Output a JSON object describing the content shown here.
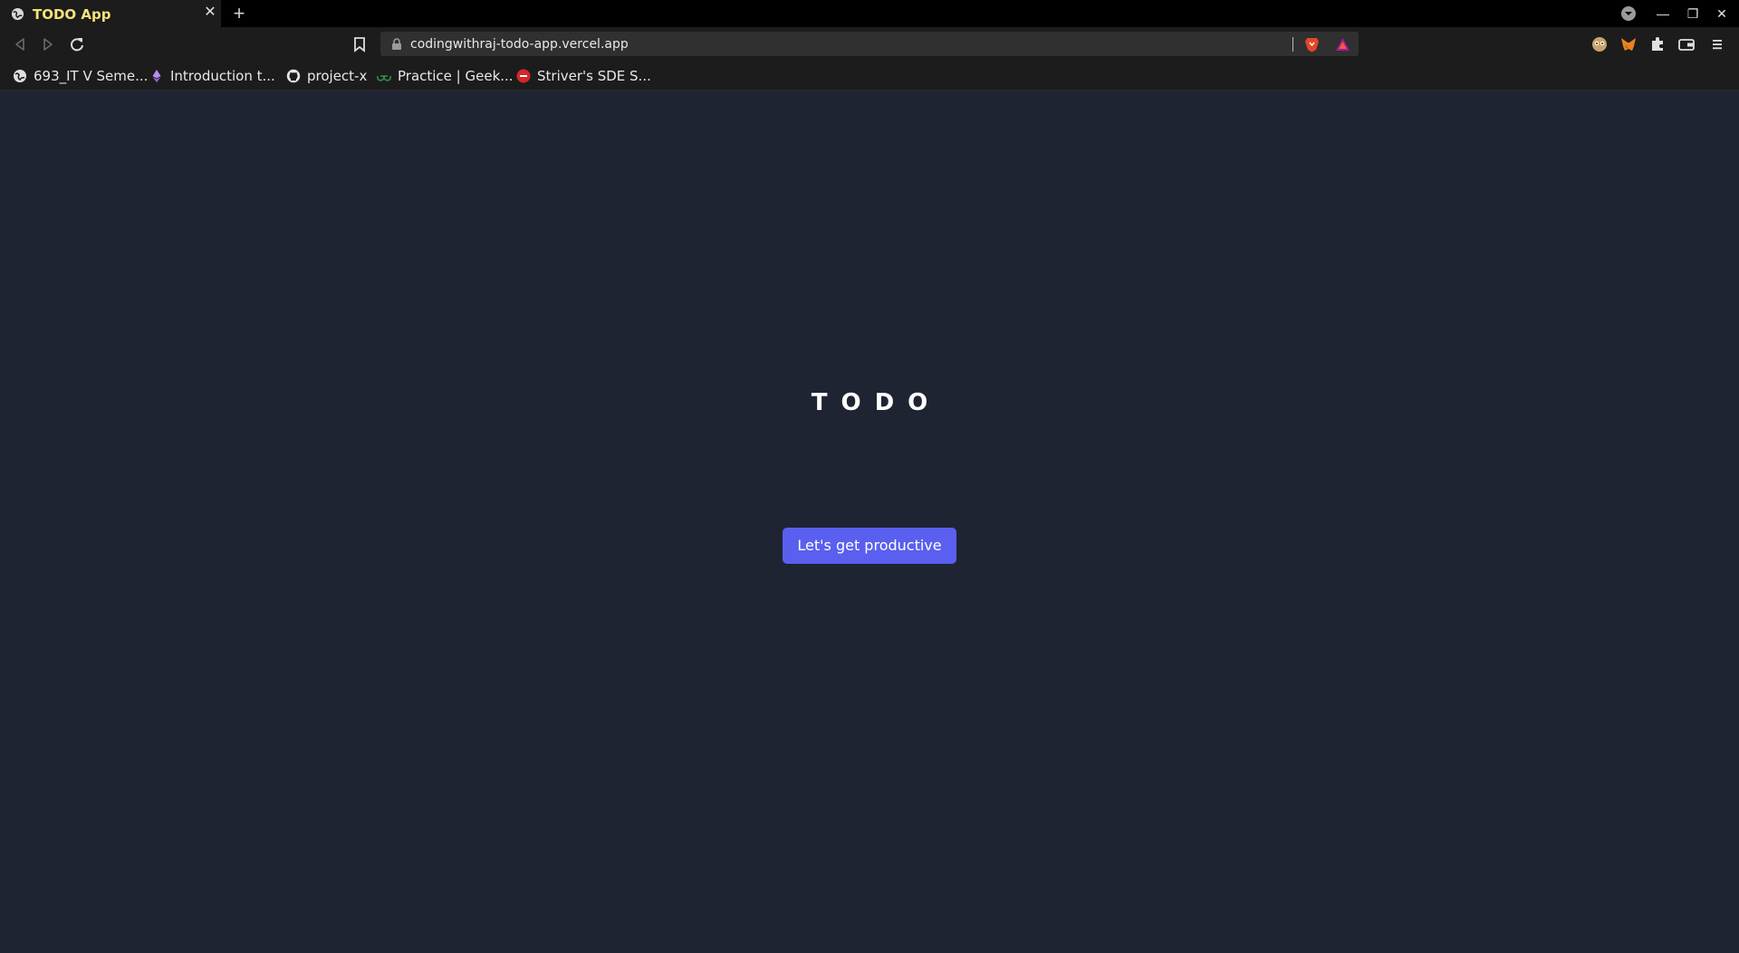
{
  "tab": {
    "title": "TODO App",
    "close_glyph": "✕",
    "new_tab_glyph": "+"
  },
  "window_controls": {
    "dropdown_icon": "chevron-down-circle-icon",
    "minimize_glyph": "—",
    "maximize_glyph": "❐",
    "close_glyph": "✕"
  },
  "toolbar": {
    "url": "codingwithraj-todo-app.vercel.app"
  },
  "bookmarks": [
    {
      "label": "693_IT V Seme...",
      "icon": "globe-icon"
    },
    {
      "label": "Introduction t...",
      "icon": "ethereum-icon"
    },
    {
      "label": "project-x",
      "icon": "github-icon"
    },
    {
      "label": "Practice | Geek...",
      "icon": "geeksforgeeks-icon"
    },
    {
      "label": "Striver's SDE S...",
      "icon": "takeuforward-icon"
    }
  ],
  "page": {
    "title": "TODO",
    "cta_label": "Let's get productive"
  },
  "colors": {
    "page_background": "#1f2433",
    "button_accent": "#5a5ff0",
    "tab_title": "#f2e27a"
  }
}
